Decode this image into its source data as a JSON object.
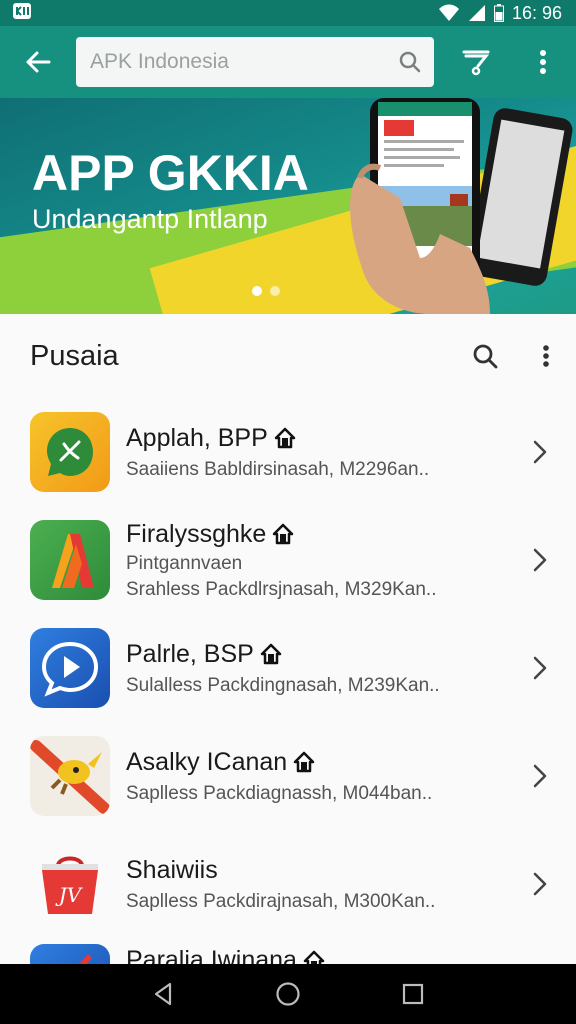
{
  "status_bar": {
    "time": "16: 96"
  },
  "search": {
    "placeholder": "APK Indonesia"
  },
  "banner": {
    "title": "APP GKKIA",
    "subtitle": "Undangantp Intlanp",
    "slide_count": 3,
    "active_slide": 1
  },
  "section": {
    "title": "Pusaia"
  },
  "apps": [
    {
      "name": "Applah, BPP",
      "meta": "Saaiiens Babldirsinasah, M2296an..",
      "icon": "whatsapp-style-icon",
      "color": "#f5b21e"
    },
    {
      "name": "Firalyssghke",
      "subtitle": "Pintgannvaen",
      "meta": "Srahless Packdlrsjnasah, M329Kan..",
      "icon": "a-triangle-icon",
      "color": "#4caf50"
    },
    {
      "name": "Palrle, BSP",
      "meta": "Sulalless Packdingnasah, M239Kan..",
      "icon": "play-bubble-icon",
      "color": "#1f64c8"
    },
    {
      "name": "Asalky ICanan",
      "meta": "Saplless Packdiagnassh, M044ban..",
      "icon": "pencil-bird-icon",
      "color": "#e8e4da"
    },
    {
      "name": "Shaiwiis",
      "meta": "Saplless Packdirajnasah, M300Kan..",
      "icon": "shopping-bag-icon",
      "color": "#e53935"
    },
    {
      "name": "Paralia Iwinana",
      "meta": "",
      "icon": "blue-app-icon",
      "color": "#1f64c8"
    }
  ]
}
